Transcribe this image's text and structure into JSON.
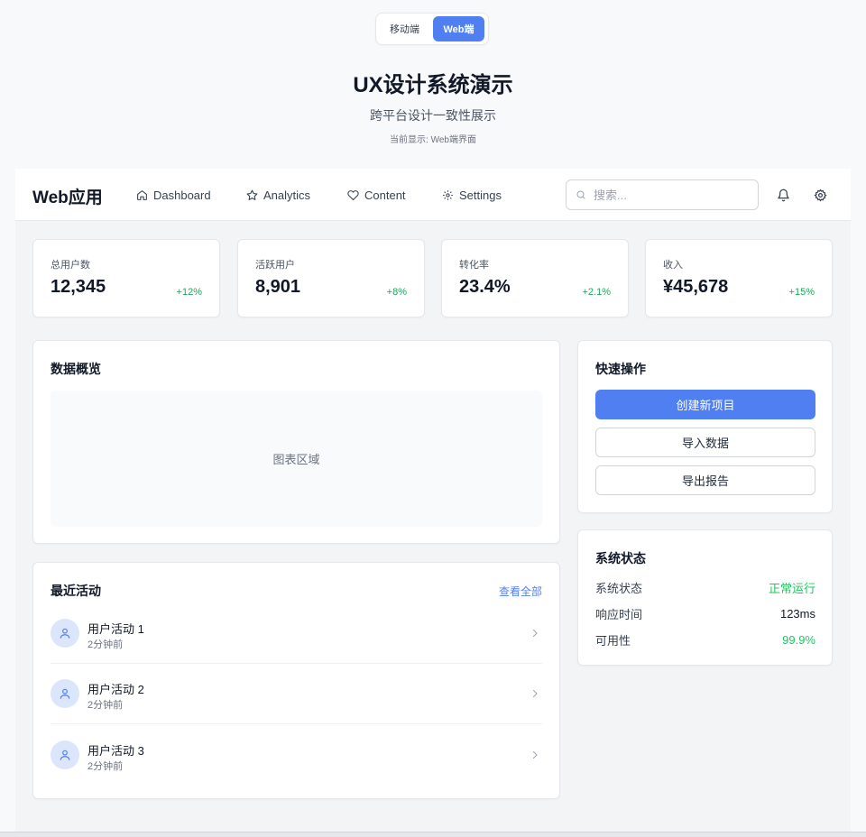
{
  "toggle": {
    "mobile_label": "移动端",
    "web_label": "Web端"
  },
  "hero": {
    "title": "UX设计系统演示",
    "subtitle": "跨平台设计一致性展示",
    "current": "当前显示: Web端界面"
  },
  "navbar": {
    "brand": "Web应用",
    "items": [
      {
        "label": "Dashboard",
        "icon": "home-icon"
      },
      {
        "label": "Analytics",
        "icon": "star-icon"
      },
      {
        "label": "Content",
        "icon": "heart-icon"
      },
      {
        "label": "Settings",
        "icon": "gear-icon"
      }
    ],
    "search_placeholder": "搜索...",
    "icons": [
      "bell-icon",
      "gear-icon"
    ]
  },
  "stats": [
    {
      "label": "总用户数",
      "value": "12,345",
      "change": "+12%"
    },
    {
      "label": "活跃用户",
      "value": "8,901",
      "change": "+8%"
    },
    {
      "label": "转化率",
      "value": "23.4%",
      "change": "+2.1%"
    },
    {
      "label": "收入",
      "value": "¥45,678",
      "change": "+15%"
    }
  ],
  "overview": {
    "title": "数据概览",
    "placeholder": "图表区域"
  },
  "activity": {
    "title": "最近活动",
    "view_all": "查看全部",
    "items": [
      {
        "title": "用户活动 1",
        "time": "2分钟前"
      },
      {
        "title": "用户活动 2",
        "time": "2分钟前"
      },
      {
        "title": "用户活动 3",
        "time": "2分钟前"
      }
    ]
  },
  "quick": {
    "title": "快速操作",
    "create": "创建新项目",
    "import": "导入数据",
    "export": "导出报告"
  },
  "system": {
    "title": "系统状态",
    "rows": [
      {
        "key": "系统状态",
        "value": "正常运行"
      },
      {
        "key": "响应时间",
        "value": "123ms"
      },
      {
        "key": "可用性",
        "value": "99.9%"
      }
    ]
  },
  "colors": {
    "accent": "#4f7ff0",
    "success": "#22c55e",
    "background": "#f3f4f6"
  }
}
